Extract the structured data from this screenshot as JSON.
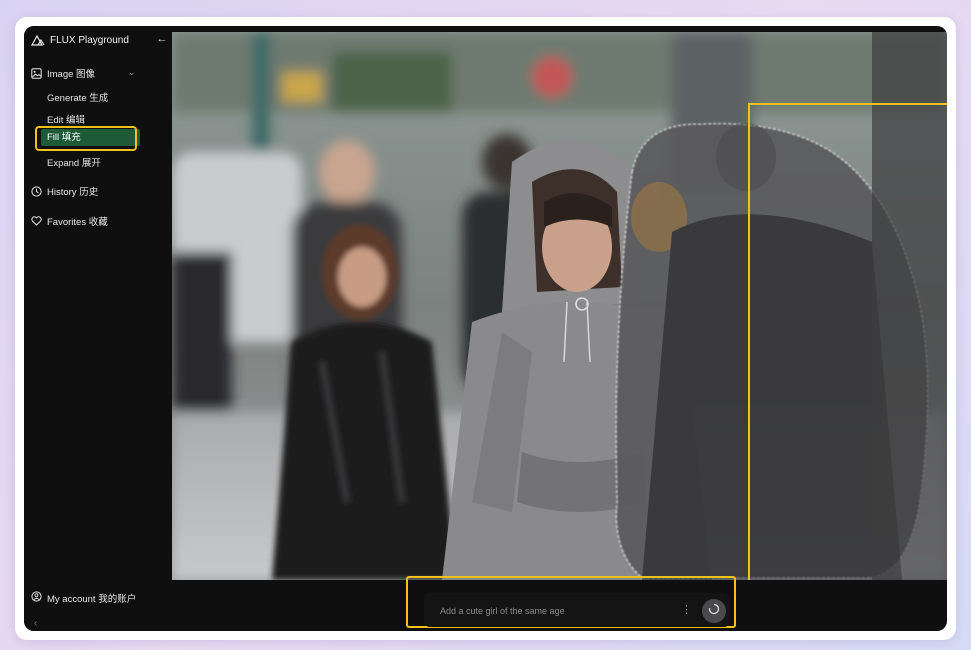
{
  "app": {
    "title": "FLUX Playground"
  },
  "sidebar": {
    "image_group": {
      "label": "Image 图像"
    },
    "sub_items": [
      {
        "label": "Generate 生成",
        "active": false
      },
      {
        "label": "Edit 编辑",
        "active": false
      },
      {
        "label": "Fill 填充",
        "active": true
      },
      {
        "label": "Expand 展开",
        "active": false
      }
    ],
    "history": {
      "label": "History 历史"
    },
    "favorites": {
      "label": "Favorites 收藏"
    },
    "account": {
      "label": "My account 我的账户"
    }
  },
  "prompt": {
    "placeholder": "Add a cute girl of the same age"
  },
  "colors": {
    "accent_highlight": "#f2c21b",
    "active_item_bg": "#1d5a37",
    "app_bg": "#0f0f10"
  },
  "icons": [
    "logo-icon",
    "back-arrow-icon",
    "image-icon",
    "chevron-down-icon",
    "history-clock-icon",
    "heart-icon",
    "user-circle-icon",
    "more-vertical-icon",
    "send-spinner-icon"
  ]
}
